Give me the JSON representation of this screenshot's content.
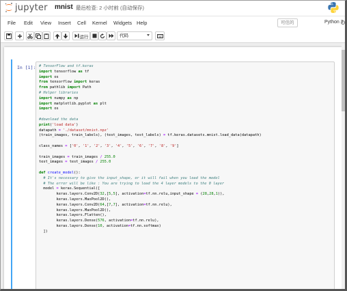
{
  "header": {
    "logo_text": "jupyter",
    "notebook_name": "mnist",
    "checkpoint": "最后检查: 2 小时前  (自动保存)"
  },
  "menu": {
    "items": [
      "File",
      "Edit",
      "View",
      "Insert",
      "Cell",
      "Kernel",
      "Widgets",
      "Help"
    ],
    "trusted_label": "可信的",
    "kernel_name": "Python 3"
  },
  "toolbar": {
    "run_label": "运行",
    "cell_type": "代码",
    "icons": [
      "save-icon",
      "add-cell-icon",
      "cut-icon",
      "copy-icon",
      "paste-icon",
      "move-up-icon",
      "move-down-icon",
      "run-icon",
      "stop-icon",
      "restart-icon",
      "fast-forward-icon",
      "keyboard-icon"
    ]
  },
  "cell": {
    "prompt": "In  [1]:",
    "code_lines": [
      "# TensorFlow and tf.keras",
      "import tensorflow as tf",
      "import os",
      "from tensorflow import keras",
      "from pathlib import Path",
      "# Helper libraries",
      "import numpy as np",
      "import matplotlib.pyplot as plt",
      "import os",
      "",
      "#download the data",
      "print('load data')",
      "datapath = './dataset/mnist.npz'",
      "(train_images, train_labels), (test_images, test_labels) = tf.keras.datasets.mnist.load_data(datapath)",
      "",
      "class_names = ['0', '1', '2', '3', '4', '5', '6', '7', '8', '9']",
      "",
      "train_images = train_images / 255.0",
      "test_images = test_images / 255.0",
      "",
      "def create_model():",
      "  # It's necessary to give the input_shape, or it will fail when you load the model",
      "  # The error will be like : You are trying to load the 4 layer models to the 0 layer",
      "  model = keras.Sequential([",
      "        keras.layers.Conv2D(32,[5,5], activation=tf.nn.relu,input_shape = (28,28,1)),",
      "        keras.layers.MaxPool2D(),",
      "        keras.layers.Conv2D(64,[7,7], activation=tf.nn.relu),",
      "        keras.layers.MaxPool2D(),",
      "        keras.layers.Flatten(),",
      "        keras.layers.Dense(576, activation=tf.nn.relu),",
      "        keras.layers.Dense(10, activation=tf.nn.softmax)",
      "  ])"
    ]
  }
}
